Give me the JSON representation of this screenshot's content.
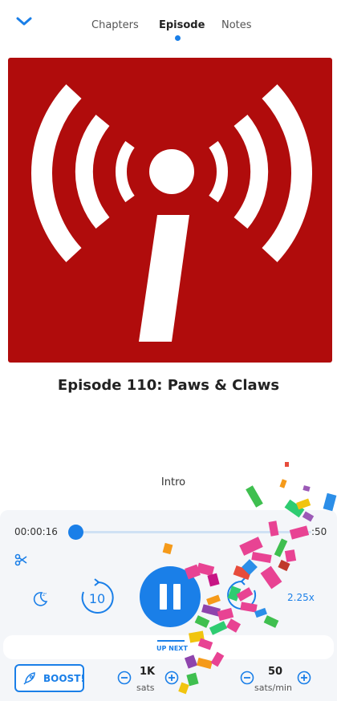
{
  "header": {
    "back_icon": "chevron-down-icon",
    "tabs": [
      {
        "label": "Chapters"
      },
      {
        "label": "Episode"
      },
      {
        "label": "Notes"
      }
    ],
    "active_tab": "Episode"
  },
  "artwork": {
    "icon": "broadcast-info-icon",
    "background_color": "#b00c0c"
  },
  "episode": {
    "title": "Episode 110: Paws & Claws",
    "chapter": "Intro"
  },
  "player": {
    "current_time": "00:00:16",
    "total_time_visible": ":50",
    "progress_fraction": 0.01,
    "rewind_seconds": "10",
    "speed": "2.25x",
    "up_next_label": "UP NEXT",
    "accent_color": "#1a7fe8"
  },
  "boost": {
    "label": "BOOST!",
    "amount": "1K",
    "amount_unit": "sats",
    "rate": "50",
    "rate_unit": "sats/min"
  }
}
